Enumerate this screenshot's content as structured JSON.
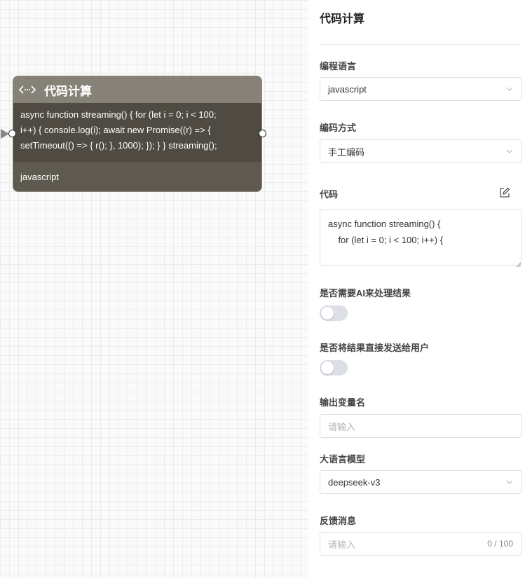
{
  "node": {
    "title": "代码计算",
    "code_preview_line1": "async function streaming() { for (let i = 0; i < 100;",
    "code_preview_line2": "i++) { console.log(i); await new Promise((r) => {",
    "code_preview_line3": "setTimeout(() => { r(); }, 1000); }); } } streaming();",
    "language": "javascript"
  },
  "panel": {
    "title": "代码计算",
    "language_label": "编程语言",
    "language_value": "javascript",
    "coding_mode_label": "编码方式",
    "coding_mode_value": "手工编码",
    "code_label": "代码",
    "code_value": "async function streaming() {\n    for (let i = 0; i < 100; i++) {",
    "ai_process_label": "是否需要AI来处理结果",
    "ai_process_enabled": false,
    "send_to_user_label": "是否将结果直接发送给用户",
    "send_to_user_enabled": false,
    "output_var_label": "输出变量名",
    "output_var_placeholder": "请输入",
    "llm_label": "大语言模型",
    "llm_value": "deepseek-v3",
    "feedback_label": "反馈消息",
    "feedback_placeholder": "请输入",
    "feedback_counter": "0 / 100"
  },
  "icons": {
    "node_icon": "code-icon",
    "edit": "edit-icon",
    "dropdown": "chevron-down-icon"
  }
}
